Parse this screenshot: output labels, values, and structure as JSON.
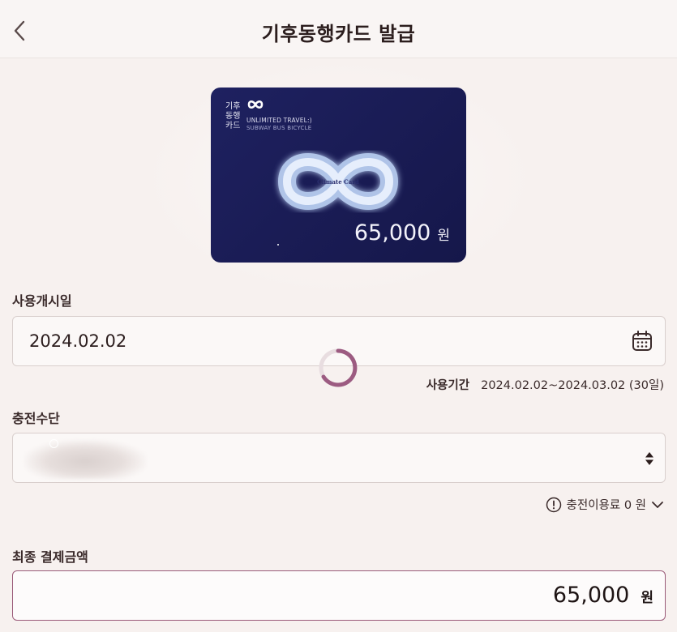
{
  "header": {
    "title": "기후동행카드 발급"
  },
  "card": {
    "ko_lines": [
      "기후",
      "동행",
      "카드"
    ],
    "en_line1": "UNLIMITED TRAVEL:)",
    "en_line2": "SUBWAY BUS BICYCLE",
    "center_text": "Climate Card",
    "amount": "65,000",
    "unit": "원"
  },
  "start_date": {
    "label": "사용개시일",
    "value": "2024.02.02"
  },
  "usage_period": {
    "label": "사용기간",
    "value": "2024.02.02~2024.03.02 (30일)"
  },
  "payment_method": {
    "label": "충전수단"
  },
  "fee": {
    "text": "충전이용료 0 원"
  },
  "total": {
    "label": "최종 결제금액",
    "amount": "65,000",
    "unit": "원"
  },
  "colors": {
    "background": "#f7f1ef",
    "card": "#1e2160",
    "accent_border": "#9a5a78",
    "spinner": "#8e4470"
  },
  "icons": [
    "chevron-left-icon",
    "infinity-logo-icon",
    "calendar-icon",
    "loading-spinner-icon",
    "sort-updown-icon",
    "info-circle-icon",
    "chevron-down-icon"
  ]
}
